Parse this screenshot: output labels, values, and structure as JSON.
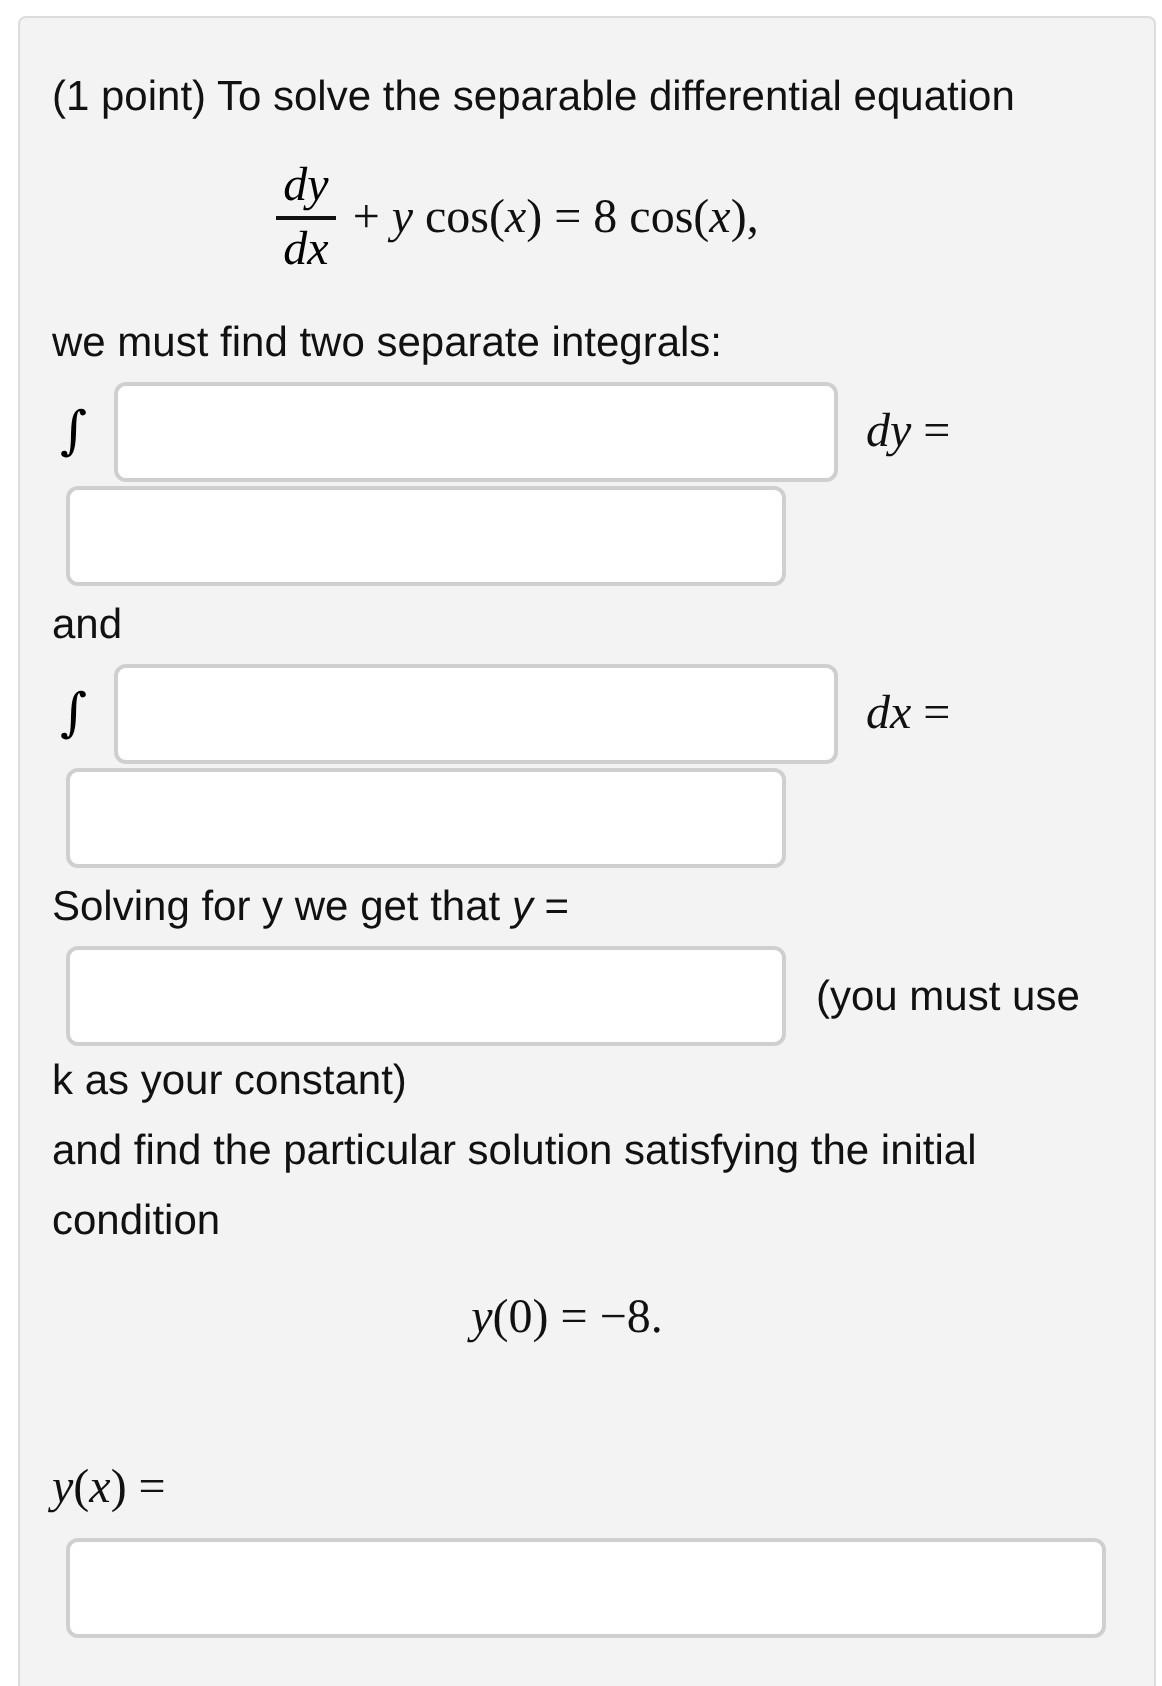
{
  "problem": {
    "intro": "(1 point) To solve the separable differential equation",
    "equation": {
      "numerator": "dy",
      "denominator": "dx",
      "rest": "+ *y* cos(*x*) = 8 cos(*x*),"
    },
    "instruction": "we must find two separate integrals:",
    "integrals": [
      {
        "sign": "∫",
        "differential": "*dy* ="
      },
      {
        "sign": "∫",
        "differential": "*dx* ="
      }
    ],
    "connector": "and",
    "solve_prompt": "Solving for y we get that *y* =",
    "constant_note": [
      "(you must use",
      "k as your constant)"
    ],
    "condition_text": "and find the particular solution satisfying the initial condition",
    "initial_condition": "*y*(0) = −8.",
    "answer_label": "*y*(*x*) ="
  }
}
